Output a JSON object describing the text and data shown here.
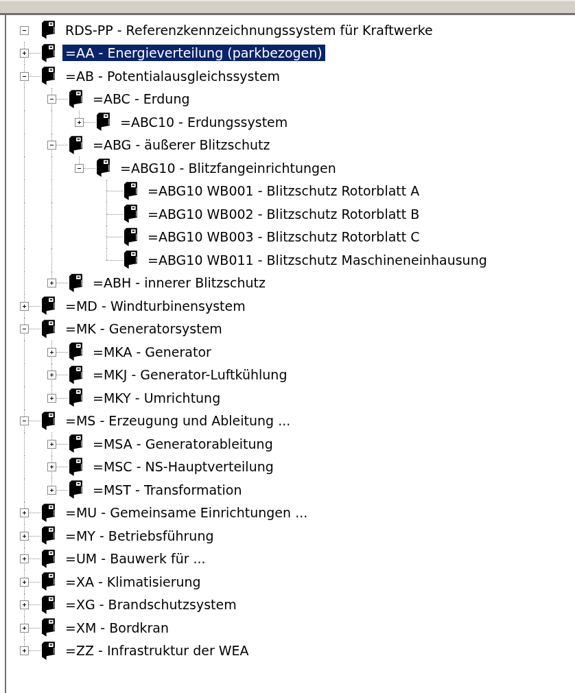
{
  "tree": [
    {
      "label": "RDS-PP - Referenzkennzeichnungssystem für Kraftwerke",
      "expanded": true,
      "selected": false,
      "children": [
        {
          "label": "=AA - Energieverteilung (parkbezogen)",
          "expanded": false,
          "selected": true
        },
        {
          "label": "=AB - Potentialausgleichssystem",
          "expanded": true,
          "selected": false,
          "children": [
            {
              "label": "=ABC - Erdung",
              "expanded": true,
              "selected": false,
              "children": [
                {
                  "label": "=ABC10 - Erdungssystem",
                  "expanded": false,
                  "selected": false
                }
              ]
            },
            {
              "label": "=ABG - äußerer Blitzschutz",
              "expanded": true,
              "selected": false,
              "children": [
                {
                  "label": "=ABG10 - Blitzfangeinrichtungen",
                  "expanded": true,
                  "selected": false,
                  "children": [
                    {
                      "label": "=ABG10 WB001 - Blitzschutz Rotorblatt A",
                      "selected": false
                    },
                    {
                      "label": "=ABG10 WB002 - Blitzschutz Rotorblatt B",
                      "selected": false
                    },
                    {
                      "label": "=ABG10 WB003 - Blitzschutz Rotorblatt C",
                      "selected": false
                    },
                    {
                      "label": "=ABG10 WB011 - Blitzschutz Maschineneinhausung",
                      "selected": false
                    }
                  ]
                }
              ]
            },
            {
              "label": "=ABH - innerer Blitzschutz",
              "expanded": false,
              "selected": false
            }
          ]
        },
        {
          "label": "=MD - Windturbinensystem",
          "expanded": false,
          "selected": false
        },
        {
          "label": "=MK - Generatorsystem",
          "expanded": true,
          "selected": false,
          "children": [
            {
              "label": "=MKA - Generator",
              "expanded": false,
              "selected": false
            },
            {
              "label": "=MKJ - Generator-Luftkühlung",
              "expanded": false,
              "selected": false
            },
            {
              "label": "=MKY - Umrichtung",
              "expanded": false,
              "selected": false
            }
          ]
        },
        {
          "label": "=MS - Erzeugung und Ableitung ...",
          "expanded": true,
          "selected": false,
          "children": [
            {
              "label": "=MSA - Generatorableitung",
              "expanded": false,
              "selected": false
            },
            {
              "label": "=MSC - NS-Hauptverteilung",
              "expanded": false,
              "selected": false
            },
            {
              "label": "=MST - Transformation",
              "expanded": false,
              "selected": false
            }
          ]
        },
        {
          "label": "=MU - Gemeinsame Einrichtungen ...",
          "expanded": false,
          "selected": false
        },
        {
          "label": "=MY - Betriebsführung",
          "expanded": false,
          "selected": false
        },
        {
          "label": "=UM - Bauwerk für ...",
          "expanded": false,
          "selected": false
        },
        {
          "label": "=XA - Klimatisierung",
          "expanded": false,
          "selected": false
        },
        {
          "label": "=XG - Brandschutzsystem",
          "expanded": false,
          "selected": false
        },
        {
          "label": "=XM - Bordkran",
          "expanded": false,
          "selected": false
        },
        {
          "label": "=ZZ - Infrastruktur der WEA",
          "expanded": false,
          "selected": false
        }
      ]
    }
  ]
}
